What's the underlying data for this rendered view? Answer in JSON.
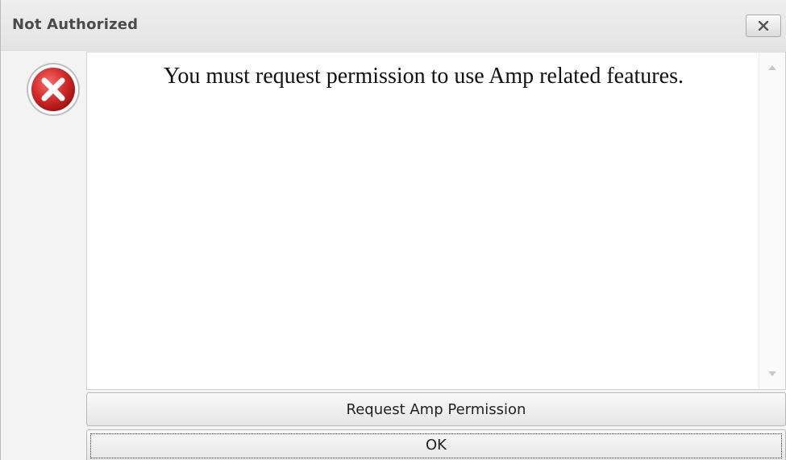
{
  "dialog": {
    "title": "Not Authorized",
    "close_icon": "close-x-icon",
    "status_icon": "error-circle-x-icon",
    "message": "You must request permission to use Amp related features.",
    "buttons": {
      "request_label": "Request Amp Permission",
      "ok_label": "OK"
    },
    "colors": {
      "error_red": "#d42a2a",
      "titlebar": "#e8e8e8",
      "content_bg": "#ffffff"
    }
  }
}
